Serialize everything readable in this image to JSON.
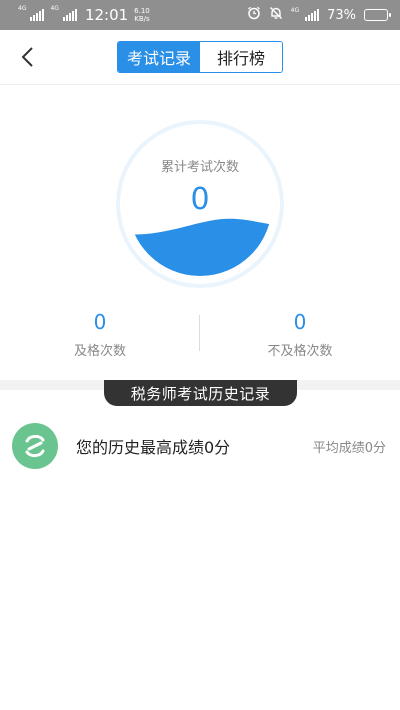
{
  "status": {
    "network1": "4G",
    "network2": "4G",
    "time": "12:01",
    "speed_value": "6.10",
    "speed_unit": "KB/s",
    "network3": "4G",
    "battery_percent_text": "73%",
    "battery_level": 0.73
  },
  "header": {
    "tabs": [
      {
        "label": "考试记录",
        "active": true
      },
      {
        "label": "排行榜",
        "active": false
      }
    ]
  },
  "stats": {
    "total_label": "累计考试次数",
    "total_value": "0",
    "wave_fill": 0.35,
    "pass_value": "0",
    "pass_label": "及格次数",
    "fail_value": "0",
    "fail_label": "不及格次数"
  },
  "history": {
    "section_title": "税务师考试历史记录",
    "best_text": "您的历史最高成绩0分",
    "avg_text": "平均成绩0分"
  },
  "colors": {
    "accent": "#2a8fe6",
    "logo": "#6ac48f",
    "pill": "#333333"
  }
}
